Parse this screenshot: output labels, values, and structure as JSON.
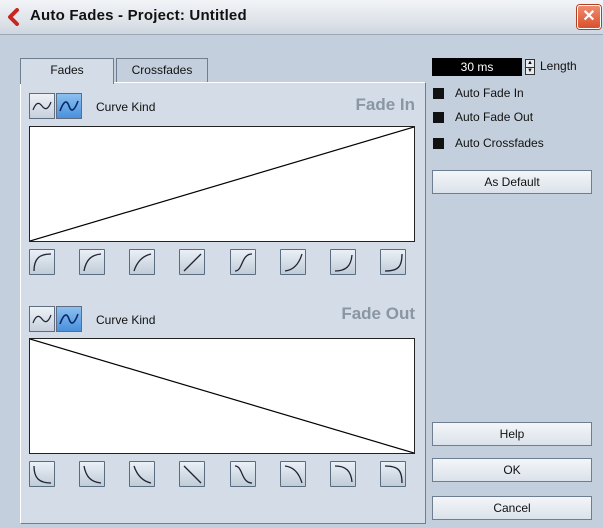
{
  "window": {
    "title": "Auto Fades - Project: Untitled",
    "close_label": "✕",
    "accent": "#d9502d",
    "brand": "#c8261e"
  },
  "tabs": [
    {
      "label": "Fades",
      "active": true
    },
    {
      "label": "Crossfades",
      "active": false
    }
  ],
  "fade_in": {
    "title": "Fade In",
    "curve_kind_label": "Curve Kind",
    "presets": [
      "fade-in-curve-1",
      "fade-in-curve-2",
      "fade-in-curve-3",
      "fade-in-linear",
      "fade-in-s-curve",
      "fade-in-curve-6",
      "fade-in-curve-7",
      "fade-in-curve-8"
    ]
  },
  "fade_out": {
    "title": "Fade Out",
    "curve_kind_label": "Curve Kind",
    "presets": [
      "fade-out-curve-1",
      "fade-out-curve-2",
      "fade-out-curve-3",
      "fade-out-linear",
      "fade-out-s-curve",
      "fade-out-curve-6",
      "fade-out-curve-7",
      "fade-out-curve-8"
    ]
  },
  "length": {
    "value": "30 ms",
    "label": "Length"
  },
  "options": [
    {
      "label": "Auto Fade In",
      "checked": true
    },
    {
      "label": "Auto Fade Out",
      "checked": true
    },
    {
      "label": "Auto Crossfades",
      "checked": true
    }
  ],
  "buttons": {
    "as_default": "As Default",
    "help": "Help",
    "ok": "OK",
    "cancel": "Cancel"
  }
}
